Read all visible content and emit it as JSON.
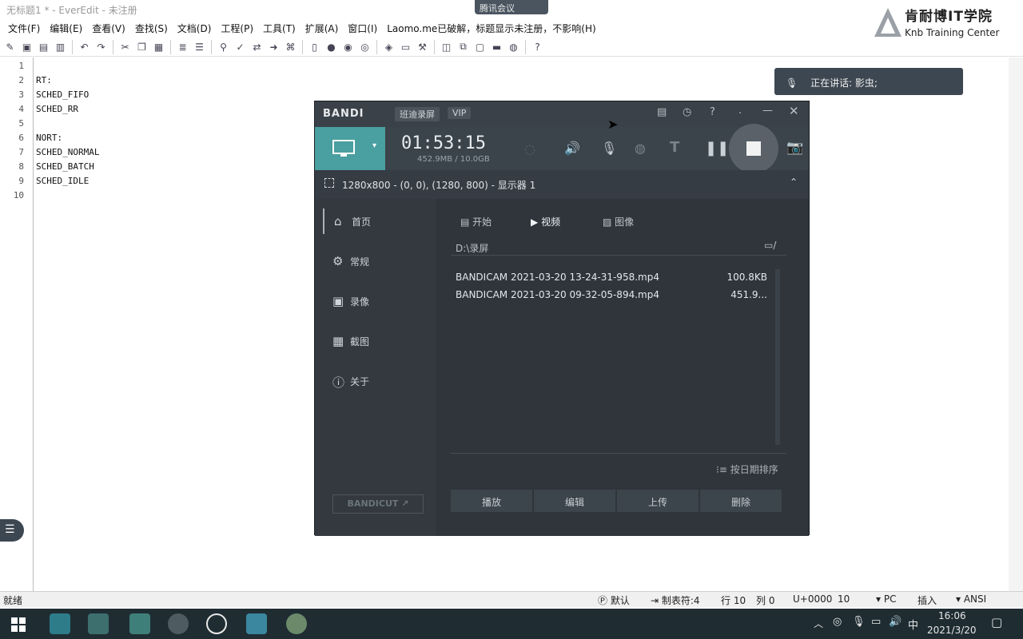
{
  "window": {
    "title": "无标题1 * - EverEdit - 未注册"
  },
  "meeting_badge": "腾讯会议",
  "logo": {
    "cn": "肯耐博IT学院",
    "en": "Knb Training Center"
  },
  "menu": [
    "文件(F)",
    "编辑(E)",
    "查看(V)",
    "查找(S)",
    "文档(D)",
    "工程(P)",
    "工具(T)",
    "扩展(A)",
    "窗口(I)",
    "Laomo.me已破解，标题显示未注册，不影响(H)"
  ],
  "editor": {
    "line_numbers": [
      "1",
      "2",
      "3",
      "4",
      "5",
      "6",
      "7",
      "8",
      "9",
      "10"
    ],
    "lines": [
      "",
      "RT:",
      "SCHED_FIFO",
      "SCHED_RR",
      "",
      "NORT:",
      "SCHED_NORMAL",
      "SCHED_BATCH",
      "SCHED_IDLE",
      ""
    ]
  },
  "speaking": {
    "label": "正在讲话: 影虫;"
  },
  "bandicam": {
    "brand": "BANDI",
    "badge_record": "班迪录屏",
    "badge_vip": "VIP",
    "timer": "01:53:15",
    "size": "452.9MB / 10.0GB",
    "region": "1280x800 - (0, 0), (1280, 800) - 显示器 1",
    "nav": [
      "首页",
      "常规",
      "录像",
      "截图",
      "关于"
    ],
    "tabs": [
      "开始",
      "视频",
      "图像"
    ],
    "path": "D:\\录屏",
    "files": [
      {
        "name": "BANDICAM 2021-03-20 13-24-31-958.mp4",
        "size": "100.8KB"
      },
      {
        "name": "BANDICAM 2021-03-20 09-32-05-894.mp4",
        "size": "451.9..."
      }
    ],
    "sort": "按日期排序",
    "actions": [
      "播放",
      "编辑",
      "上传",
      "删除"
    ],
    "bandicut": "BANDICUT ↗"
  },
  "status": {
    "ready": "就绪",
    "mode": "默认",
    "tab": "制表符:4",
    "row": "行 10",
    "col": "列 0",
    "unicode": "U+0000",
    "num": "10",
    "eol": "PC",
    "ins": "插入",
    "enc": "ANSI"
  },
  "taskbar": {
    "ime": "中",
    "time": "16:06",
    "date": "2021/3/20"
  },
  "colors": {
    "accent": "#4a9fa0",
    "bandi_bg": "#2a2f35"
  }
}
